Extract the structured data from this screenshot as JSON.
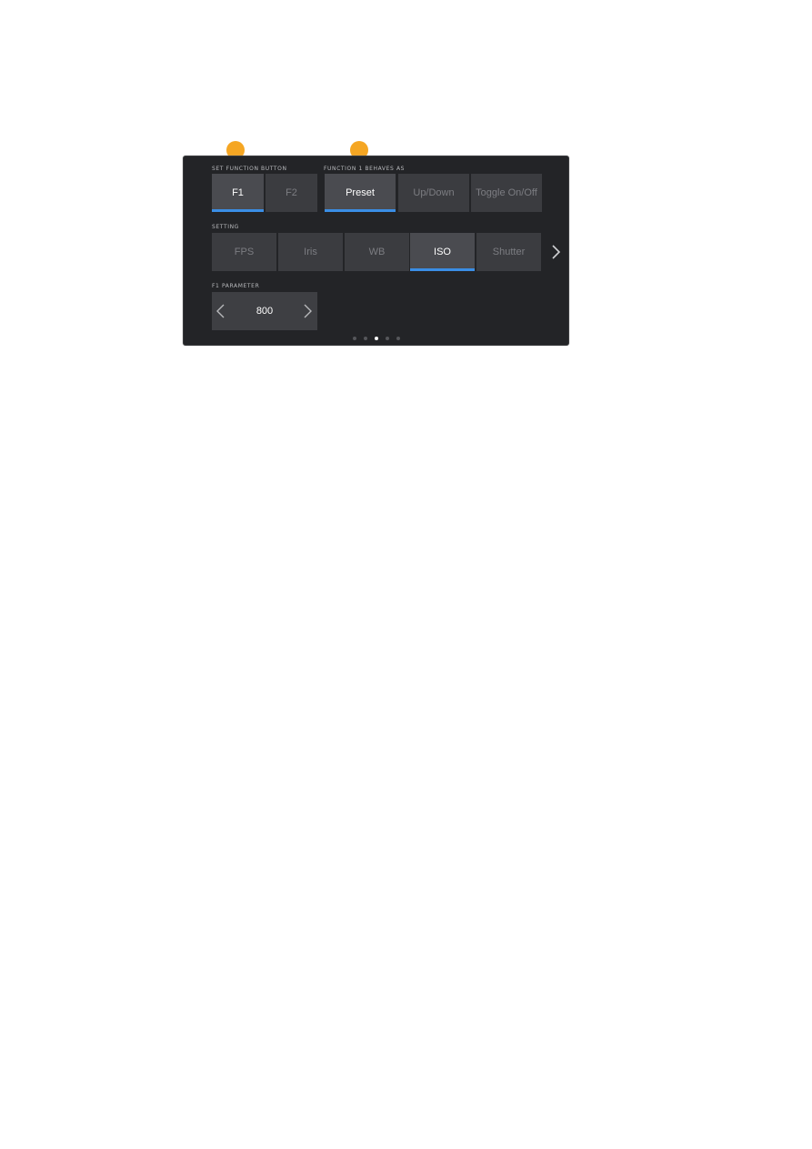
{
  "screen": {
    "set_function_button": {
      "label": "SET FUNCTION BUTTON",
      "options": [
        {
          "label": "F1",
          "active": true
        },
        {
          "label": "F2",
          "active": false
        }
      ]
    },
    "function_behaves": {
      "label": "FUNCTION 1 BEHAVES AS",
      "options": [
        {
          "label": "Preset",
          "active": true
        },
        {
          "label": "Up/Down",
          "active": false
        },
        {
          "label": "Toggle On/Off",
          "active": false
        }
      ]
    },
    "setting": {
      "label": "SETTING",
      "options": [
        {
          "label": "FPS",
          "active": false
        },
        {
          "label": "Iris",
          "active": false
        },
        {
          "label": "WB",
          "active": false
        },
        {
          "label": "ISO",
          "active": true
        },
        {
          "label": "Shutter",
          "active": false
        }
      ],
      "next_icon": "chevron-right-icon"
    },
    "parameter": {
      "label": "F1 PARAMETER",
      "value": "800",
      "prev_icon": "chevron-left-icon",
      "next_icon": "chevron-right-icon"
    },
    "pagination": {
      "total": 5,
      "current": 3
    }
  },
  "colors": {
    "accent": "#3a8ee6",
    "callout": "#f5a623",
    "background": "#232427"
  }
}
